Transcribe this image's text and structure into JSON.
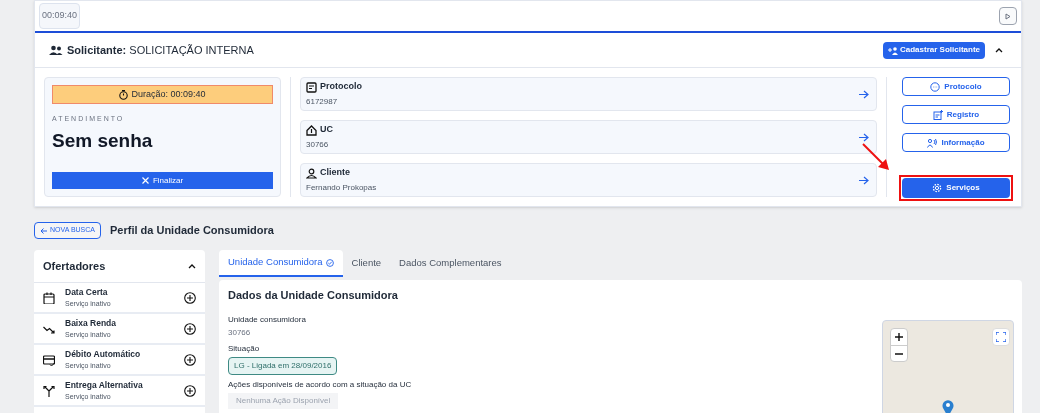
{
  "timer": "00:09:40",
  "requester": {
    "label": "Solicitante:",
    "value": "SOLICITAÇÃO INTERNA",
    "register_button": "Cadastrar Solicitante"
  },
  "attendance": {
    "duration": "Duração: 00:09:40",
    "label": "ATENDIMENTO",
    "ticket": "Sem senha",
    "finish_button": "Finalizar"
  },
  "info_cards": [
    {
      "kind": "protocol",
      "title": "Protocolo",
      "value": "6172987"
    },
    {
      "kind": "uc",
      "title": "UC",
      "value": "30766"
    },
    {
      "kind": "client",
      "title": "Cliente",
      "value": "Fernando Prokopas"
    }
  ],
  "action_buttons": [
    {
      "kind": "protocol",
      "label": "Protocolo",
      "primary": false
    },
    {
      "kind": "record",
      "label": "Registro",
      "primary": false
    },
    {
      "kind": "info",
      "label": "Informação",
      "primary": false
    },
    {
      "kind": "services",
      "label": "Serviços",
      "primary": true
    }
  ],
  "back_button": "NOVA BUSCA",
  "page_title": "Perfil da Unidade Consumidora",
  "offers": {
    "title": "Ofertadores",
    "expanded": true,
    "items": [
      {
        "kind": "calendar",
        "name": "Data Certa",
        "status": "Serviço inativo"
      },
      {
        "kind": "trend",
        "name": "Baixa Renda",
        "status": "Serviço inativo"
      },
      {
        "kind": "card",
        "name": "Débito Automático",
        "status": "Serviço inativo"
      },
      {
        "kind": "split",
        "name": "Entrega Alternativa",
        "status": "Serviço inativo"
      }
    ]
  },
  "tabs": [
    {
      "label": "Unidade Consumidora",
      "selected": true
    },
    {
      "label": "Cliente",
      "selected": false
    },
    {
      "label": "Dados Complementares",
      "selected": false
    }
  ],
  "uc_panel": {
    "title": "Dados da Unidade Consumidora",
    "fields": [
      {
        "kind": "text",
        "label": "Unidade consumidora",
        "value": "30766"
      },
      {
        "kind": "badge",
        "label": "Situação",
        "value": "LG - Ligada em 28/09/2016"
      },
      {
        "kind": "chip",
        "label": "Ações disponíveis de acordo com a situação da UC",
        "value": "Nenhuma Ação Disponível"
      }
    ]
  }
}
